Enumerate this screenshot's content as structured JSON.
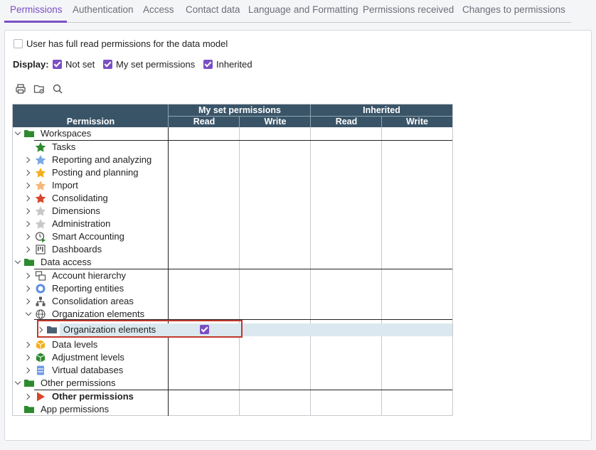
{
  "tabs": [
    {
      "label": "Permissions",
      "active": true
    },
    {
      "label": "Authentication"
    },
    {
      "label": "Access"
    },
    {
      "label": "Contact data"
    },
    {
      "label": "Language and Formatting"
    },
    {
      "label": "Permissions received"
    },
    {
      "label": "Changes to permissions"
    }
  ],
  "full_read": {
    "label": "User has full read permissions for the data model",
    "checked": false
  },
  "display": {
    "label": "Display:",
    "options": [
      {
        "label": "Not set",
        "checked": true
      },
      {
        "label": "My set permissions",
        "checked": true
      },
      {
        "label": "Inherited",
        "checked": true
      }
    ]
  },
  "toolbar": {
    "print": "print-icon",
    "folder": "folder-settings-icon",
    "search": "search-icon"
  },
  "grid": {
    "group_headers": [
      "My set permissions",
      "Inherited"
    ],
    "col_headers": [
      "Permission",
      "Read",
      "Write",
      "Read",
      "Write"
    ],
    "rows": [
      {
        "label": "Workspaces",
        "icon": "folder-icon"
      },
      {
        "label": "Tasks",
        "icon": "star-icon"
      },
      {
        "label": "Reporting and analyzing",
        "icon": "star-icon"
      },
      {
        "label": "Posting and planning",
        "icon": "star-icon"
      },
      {
        "label": "Import",
        "icon": "star-icon"
      },
      {
        "label": "Consolidating",
        "icon": "star-icon"
      },
      {
        "label": "Dimensions",
        "icon": "star-icon"
      },
      {
        "label": "Administration",
        "icon": "star-icon"
      },
      {
        "label": "Smart Accounting",
        "icon": "clock-play-icon"
      },
      {
        "label": "Dashboards",
        "icon": "dashboard-icon"
      },
      {
        "label": "Data access",
        "icon": "folder-icon"
      },
      {
        "label": "Account hierarchy",
        "icon": "hierarchy-icon"
      },
      {
        "label": "Reporting entities",
        "icon": "ring-icon"
      },
      {
        "label": "Consolidation areas",
        "icon": "org-chart-icon"
      },
      {
        "label": "Organization elements",
        "icon": "globe-icon"
      },
      {
        "label": "Organization elements",
        "icon": "folder-icon",
        "read_checked": true
      },
      {
        "label": "Data levels",
        "icon": "cube-icon"
      },
      {
        "label": "Adjustment levels",
        "icon": "cube-icon"
      },
      {
        "label": "Virtual databases",
        "icon": "database-icon"
      },
      {
        "label": "Other permissions",
        "icon": "folder-icon"
      },
      {
        "label": "Other permissions",
        "icon": "play-icon"
      },
      {
        "label": "App permissions",
        "icon": "folder-icon"
      }
    ]
  },
  "colors": {
    "accent": "#7b4fc4",
    "header": "#3a5467",
    "selection": "#dbe8ef",
    "highlight_border": "#c0392b",
    "folder": "#2e8a2e"
  }
}
